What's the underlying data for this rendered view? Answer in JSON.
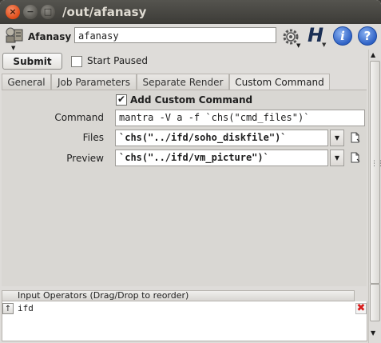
{
  "window": {
    "title": "/out/afanasy",
    "controls": {
      "close": "×",
      "minimize": "−",
      "maximize": "□"
    }
  },
  "header": {
    "node_type": "Afanasy",
    "node_name": "afanasy",
    "houdini_logo": "H",
    "info_glyph": "i",
    "help_glyph": "?"
  },
  "actions": {
    "submit_label": "Submit",
    "start_paused_label": "Start Paused",
    "start_paused_checked": false
  },
  "tabs": [
    {
      "label": "General"
    },
    {
      "label": "Job Parameters"
    },
    {
      "label": "Separate Render"
    },
    {
      "label": "Custom Command"
    }
  ],
  "custom_command": {
    "add_custom_command_label": "Add Custom Command",
    "add_custom_command_checked": true,
    "check_mark": "✔",
    "command_label": "Command",
    "command_value": "mantra -V a -f `chs(\"cmd_files\")`",
    "files_label": "Files",
    "files_value": "`chs(\"../ifd/soho_diskfile\")`",
    "preview_label": "Preview",
    "preview_value": "`chs(\"../ifd/vm_picture\")`"
  },
  "input_operators": {
    "header": "Input Operators (Drag/Drop to reorder)",
    "items": [
      {
        "name": "ifd",
        "delete_glyph": "✖",
        "move_glyph": "↑"
      }
    ]
  },
  "icons": {
    "app": "afanasy-node-icon",
    "gear": "gear-icon",
    "info": "info-icon",
    "help": "help-icon",
    "file": "file-chooser-icon"
  }
}
